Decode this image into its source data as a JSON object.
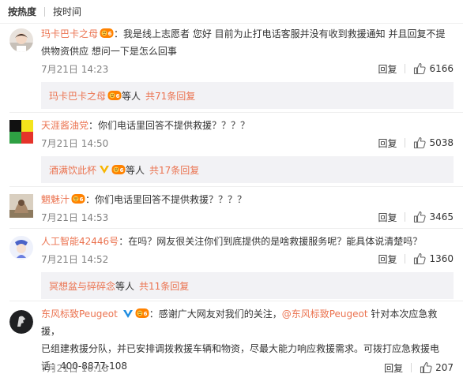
{
  "sort": {
    "hot": "按热度",
    "time": "按时间"
  },
  "reply_label": "回复",
  "comments": [
    {
      "user": "玛卡巴卡之母",
      "text": "：我是线上志愿者 您好 目前为止打电话客服并没有收到救援通知 并且回复不提",
      "text2": "供物资供应 想问一下是怎么回事",
      "time": "7月21日 14:23",
      "likes": "6166",
      "sub": {
        "user": "玛卡巴卡之母",
        "mid": " 等人 ",
        "total": "共71条回复"
      }
    },
    {
      "user": "天涯酱油党",
      "text": "：你们电话里回答不提供救援？？？？",
      "time": "7月21日 14:50",
      "likes": "5038",
      "sub": {
        "user": "酒满饮此杯",
        "mid": " 等人 ",
        "total": "共17条回复"
      }
    },
    {
      "user": "魍魅汁",
      "text": "：你们电话里回答不提供救援？？？？",
      "time": "7月21日 14:53",
      "likes": "3465"
    },
    {
      "user": "人工智能42446号",
      "text": "：在吗？网友很关注你们到底提供的是啥救援服务呢？能具体说清楚吗？",
      "time": "7月21日 14:52",
      "likes": "1360",
      "sub": {
        "user": "冥想盆与碎碎念",
        "mid": " 等人 ",
        "total": "共11条回复"
      }
    },
    {
      "user": "东风标致Peugeot",
      "text_a": "：感谢广大网友对我们的关注，",
      "mention": "@东风标致Peugeot",
      "text_b": " 针对本次应急救援，",
      "text2": "已组建救援分队，并已安排调拨救援车辆和物资，尽最大能力响应救援需求。可拨打应急救援电",
      "text3": "话：400-8877-108",
      "time": "7月21日 16:18",
      "likes": "207"
    }
  ],
  "colors": {
    "username": "#eb7350",
    "subbox_bg": "#f2f2f5",
    "vip_badge": "#ff8200",
    "verified_blue": "#1d8ce0",
    "verified_gold": "#f7b500"
  },
  "icons": [
    "thumb-up-icon",
    "vip-badge-icon",
    "verified-gold-icon",
    "verified-blue-icon"
  ]
}
